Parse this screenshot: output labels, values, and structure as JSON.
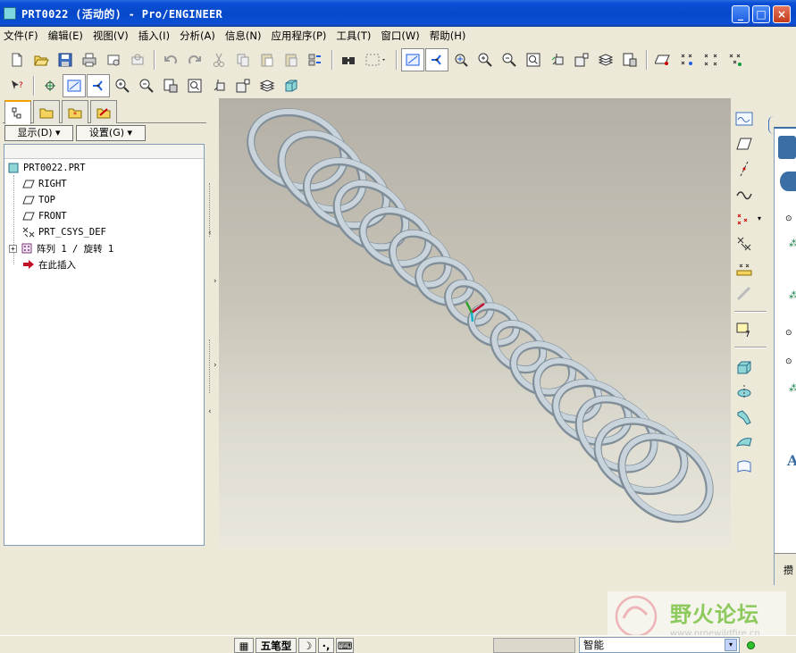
{
  "window": {
    "title": "PRT0022 (活动的) - Pro/ENGINEER",
    "buttons": {
      "minimize": "_",
      "maximize": "□",
      "close": "×"
    }
  },
  "menu": [
    "文件(F)",
    "编辑(E)",
    "视图(V)",
    "插入(I)",
    "分析(A)",
    "信息(N)",
    "应用程序(P)",
    "工具(T)",
    "窗口(W)",
    "帮助(H)"
  ],
  "toolbar_top": [
    "new-icon",
    "open-icon",
    "save-icon",
    "print-icon",
    "send-mail-icon",
    "mail-attachment-icon",
    "undo-icon",
    "redo-icon",
    "cut-icon",
    "copy-icon",
    "paste-icon",
    "paste-special-icon",
    "regenerate-icon",
    "find-icon",
    "select-box-icon",
    "datum-plane-display-icon",
    "datum-axis-display-icon",
    "datum-point-display-icon",
    "zoom-in-icon",
    "zoom-out-icon",
    "refit-icon",
    "orient-icon",
    "saved-views-icon",
    "layers-icon",
    "view-manager-icon",
    "plane-tag-icon",
    "point-tag-icon",
    "point-display-icon",
    "csys-tag-icon"
  ],
  "navigator": {
    "display_button": "显示(D)",
    "settings_button": "设置(G)",
    "tree": [
      {
        "label": "PRT0022.PRT",
        "icon": "part-icon"
      },
      {
        "label": "RIGHT",
        "icon": "datum-plane-icon"
      },
      {
        "label": "TOP",
        "icon": "datum-plane-icon"
      },
      {
        "label": "FRONT",
        "icon": "datum-plane-icon"
      },
      {
        "label": "PRT_CSYS_DEF",
        "icon": "csys-icon"
      },
      {
        "label": "阵列 1 / 旋转 1",
        "icon": "pattern-icon"
      },
      {
        "label": "在此插入",
        "icon": "insert-here-arrow-icon"
      }
    ]
  },
  "status": {
    "ime_label": "五笔型",
    "smart_filter": "智能"
  },
  "right_panel_chars": [
    "攒"
  ],
  "colors": {
    "titlebar": "#0648c8",
    "viewport_top": "#b4b0a6",
    "viewport_bottom": "#eae7dc",
    "chain": "#c9d3db",
    "chain_shadow": "#7f8e98"
  },
  "watermark": {
    "text": "野火论坛",
    "url": "www.proewildfire.cn"
  }
}
